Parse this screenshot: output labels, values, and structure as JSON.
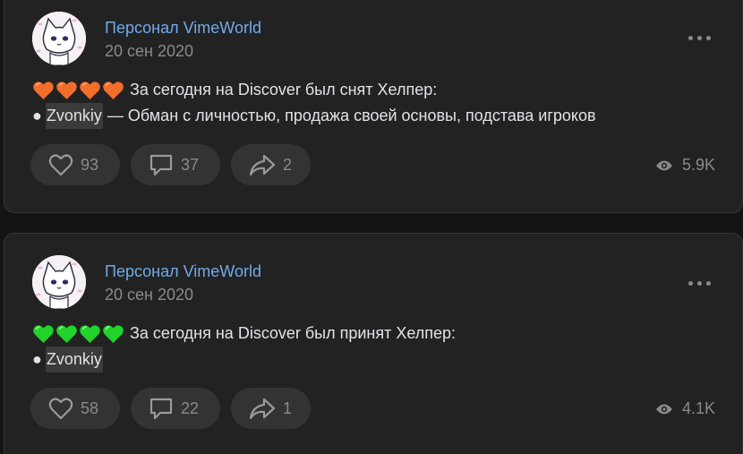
{
  "posts": [
    {
      "author": "Персонал VimeWorld",
      "date": "20 сен 2020",
      "hearts_color": "#f36d2b",
      "icons": [
        "more-icon",
        "like-icon",
        "comment-icon",
        "share-icon",
        "views-icon"
      ],
      "text_line1": "За сегодня на Discover был снят Хелпер:",
      "bullet": "●",
      "mention": "Zvonkiy",
      "text_line2_rest": " — Обман с личностью, продажа своей основы, подстава игроков",
      "likes": "93",
      "comments": "37",
      "shares": "2",
      "views": "5.9K"
    },
    {
      "author": "Персонал VimeWorld",
      "date": "20 сен 2020",
      "hearts_color": "#21d32a",
      "text_line1": "За сегодня на Discover был принят Хелпер:",
      "bullet": "●",
      "mention": "Zvonkiy",
      "likes": "58",
      "comments": "22",
      "shares": "1",
      "views": "4.1K"
    }
  ],
  "colors": {
    "background": "#141414",
    "card": "#222222",
    "link": "#71aaeb",
    "muted": "#8a8a8a",
    "text": "#e1e3e6"
  }
}
